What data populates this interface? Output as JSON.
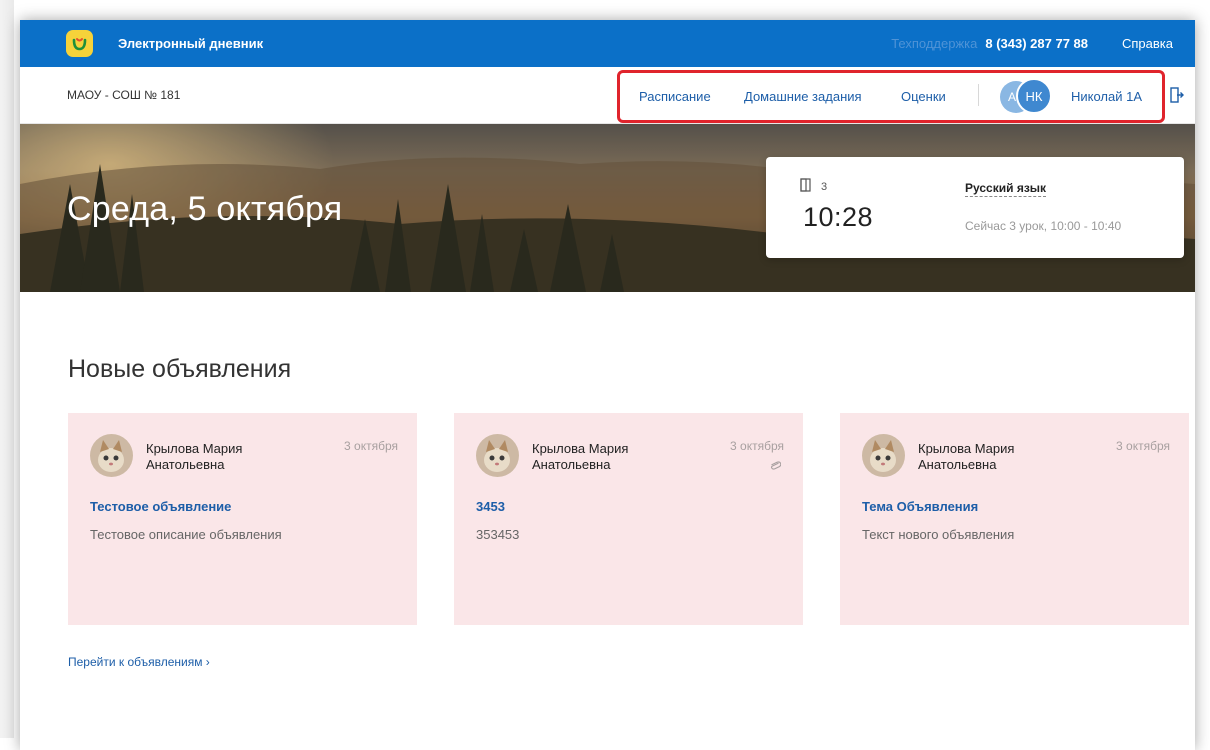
{
  "topbar": {
    "app_title": "Электронный дневник",
    "support_label": "Техподдержка",
    "support_phone": "8 (343) 287 77 88",
    "help": "Справка",
    "color": "#0b70c8",
    "logo_icon": "smile-logo-icon"
  },
  "navbar": {
    "school": "МАОУ - СОШ № 181",
    "links": [
      "Расписание",
      "Домашние задания",
      "Оценки"
    ],
    "avatar_small": "А",
    "avatar_main": "НК",
    "user": "Николай 1А",
    "highlight_color": "#e0242c"
  },
  "hero": {
    "date": "Среда, 5 октября",
    "lesson": {
      "number": "3",
      "time": "10:28",
      "subject": "Русский язык",
      "status": "Сейчас 3 урок, 10:00 - 10:40"
    }
  },
  "announcements": {
    "title": "Новые объявления",
    "items": [
      {
        "author": "Крылова Мария Анатольевна",
        "date": "3 октября",
        "title": "Тестовое объявление",
        "text": "Тестовое описание объявления",
        "attachment": false
      },
      {
        "author": "Крылова Мария Анатольевна",
        "date": "3 октября",
        "title": "3453",
        "text": "353453",
        "attachment": true
      },
      {
        "author": "Крылова Мария Анатольевна",
        "date": "3 октября",
        "title": "Тема Объявления",
        "text": "Текст нового объявления",
        "attachment": false
      }
    ],
    "goto": "Перейти к объявлениям ›"
  }
}
